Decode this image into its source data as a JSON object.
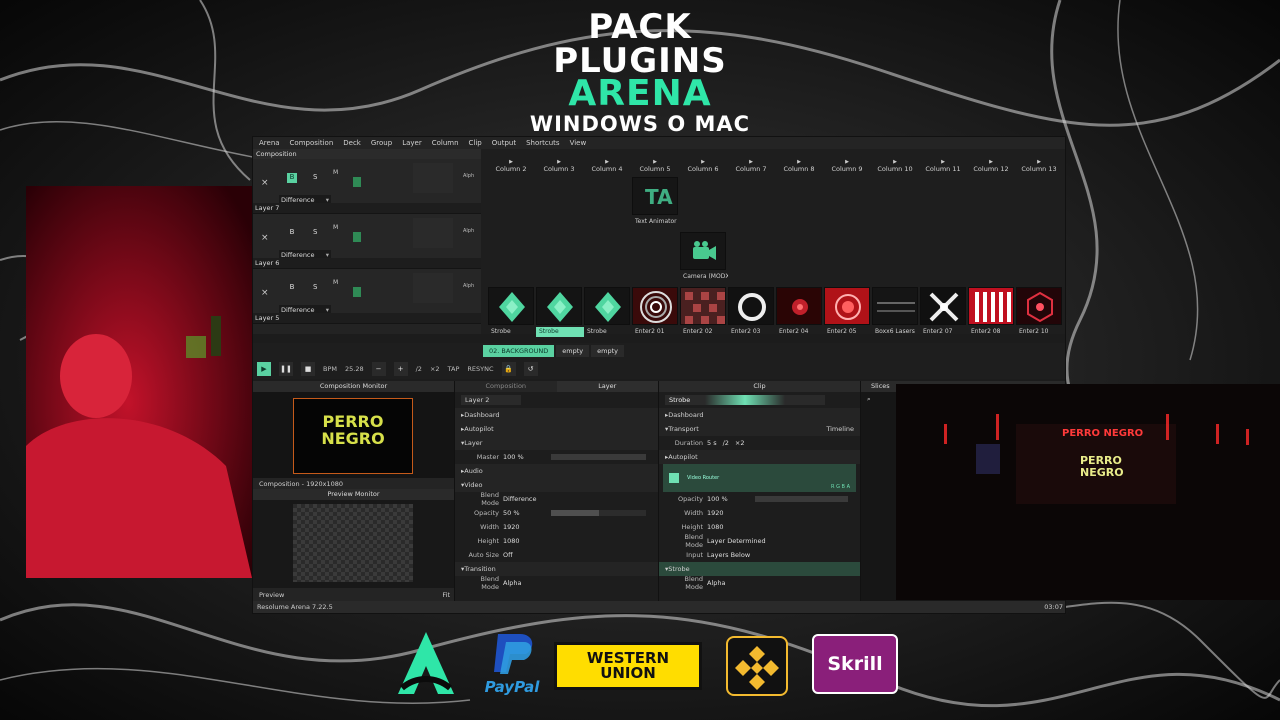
{
  "headline": {
    "line1": "PACK",
    "line2": "PLUGINS",
    "line3": "ARENA",
    "line4": "WINDOWS O MAC"
  },
  "menu": [
    "Arena",
    "Composition",
    "Deck",
    "Group",
    "Layer",
    "Column",
    "Clip",
    "Output",
    "Shortcuts",
    "View"
  ],
  "composition_label": "Composition",
  "layers": [
    {
      "name": "Layer 7",
      "blend": "Difference"
    },
    {
      "name": "Layer 6",
      "blend": "Difference"
    },
    {
      "name": "Layer 5",
      "blend": "Difference"
    }
  ],
  "layer_controls": {
    "x": "×",
    "b": "B",
    "s": "S",
    "m": "M",
    "a": "A",
    "alph": "Alph"
  },
  "columns": [
    "Column 2",
    "Column 3",
    "Column 4",
    "Column 5",
    "Column 6",
    "Column 7",
    "Column 8",
    "Column 9",
    "Column 10",
    "Column 11",
    "Column 12",
    "Column 13"
  ],
  "row1_clips": {
    "col5": "Text Animator"
  },
  "row2_clips": {
    "col6": "Camera (MODX B..."
  },
  "row3_clips": [
    "Strobe",
    "Strobe",
    "Strobe",
    "Enter2 01",
    "Enter2 02",
    "Enter2 03",
    "Enter2 04",
    "Enter2 05",
    "Boxx6 Lasers",
    "Enter2 07",
    "Enter2 08",
    "Enter2 10"
  ],
  "deck_tabs": [
    "02. BACKGROUND",
    "empty",
    "empty"
  ],
  "transport": {
    "bpm_label": "BPM",
    "bpm": "25.28",
    "div2": "/2",
    "mul2": "×2",
    "tap": "TAP",
    "resync": "RESYNC"
  },
  "panels": {
    "composition_monitor": "Composition Monitor",
    "composition_res": "Composition - 1920x1080",
    "preview_monitor": "Preview Monitor",
    "preview": "Preview",
    "fit": "Fit",
    "composition_tab": "Composition",
    "layer_tab": "Layer",
    "clip_tab": "Clip",
    "slices_tab": "Slices"
  },
  "layer_panel": {
    "name": "Layer 2",
    "dashboard": "Dashboard",
    "autopilot": "Autopilot",
    "layer": "Layer",
    "master_label": "Master",
    "master": "100 %",
    "audio": "Audio",
    "video": "Video",
    "blend_label": "Blend Mode",
    "blend": "Difference",
    "opacity_label": "Opacity",
    "opacity": "50 %",
    "width_label": "Width",
    "width": "1920",
    "height_label": "Height",
    "height": "1080",
    "autosize_label": "Auto Size",
    "autosize": "Off",
    "transition": "Transition",
    "tblend_label": "Blend Mode",
    "tblend": "Alpha"
  },
  "clip_panel": {
    "name": "Strobe",
    "dashboard": "Dashboard",
    "transport": "Transport",
    "timeline": "Timeline",
    "duration_label": "Duration",
    "duration": "5 s",
    "div": "/2",
    "mul": "×2",
    "autopilot": "Autopilot",
    "router": "Video Router",
    "rgba": "R G B A",
    "opacity_label": "Opacity",
    "opacity": "100 %",
    "width_label": "Width",
    "width": "1920",
    "height_label": "Height",
    "height": "1080",
    "blend_label": "Blend Mode",
    "blend": "Layer Determined",
    "input_label": "Input",
    "input": "Layers Below",
    "strobe": "Strobe",
    "sblend_label": "Blend Mode",
    "sblend": "Alpha"
  },
  "status": {
    "version": "Resolume Arena 7.22.5",
    "time": "03:07"
  },
  "screen_logo": {
    "line1": "PERRO",
    "line2": "NEGRO"
  },
  "payment_logos": {
    "paypal": "PayPal",
    "western": "WESTERN UNION",
    "skrill": "Skrill"
  },
  "colors": {
    "accent": "#5ad1a1",
    "headline_green": "#2fe6a8",
    "logo_yellow": "#d7e04a",
    "skrill": "#8a1f7a",
    "binance": "#f3ba2f",
    "western": "#ffdd00"
  }
}
